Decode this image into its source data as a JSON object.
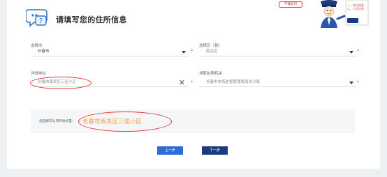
{
  "header": {
    "title": "请填写您的住所信息",
    "badge_text": "不懂就问",
    "screen_text": "一、单位信息 二、人员信息"
  },
  "form": {
    "city": {
      "label": "选择市",
      "value": "长春市"
    },
    "district": {
      "label": "选择区（县）",
      "placeholder": "南关区"
    },
    "address": {
      "label": "详细地址",
      "value": "长春市南关区三佳小区"
    },
    "authority": {
      "label": "领取执照机关",
      "placeholder": "长春市市场监督管理局南关分局"
    },
    "required_mark": "*"
  },
  "info": {
    "prefix": "您选择开公司的地点是：",
    "value": "长春市南关区三佳小区"
  },
  "buttons": {
    "prev": "上一步",
    "next": "下一步"
  },
  "colors": {
    "accent_dark": "#1c3a7e",
    "accent": "#2b6cd8",
    "highlight": "#f39c40",
    "annotation": "#e53935"
  }
}
